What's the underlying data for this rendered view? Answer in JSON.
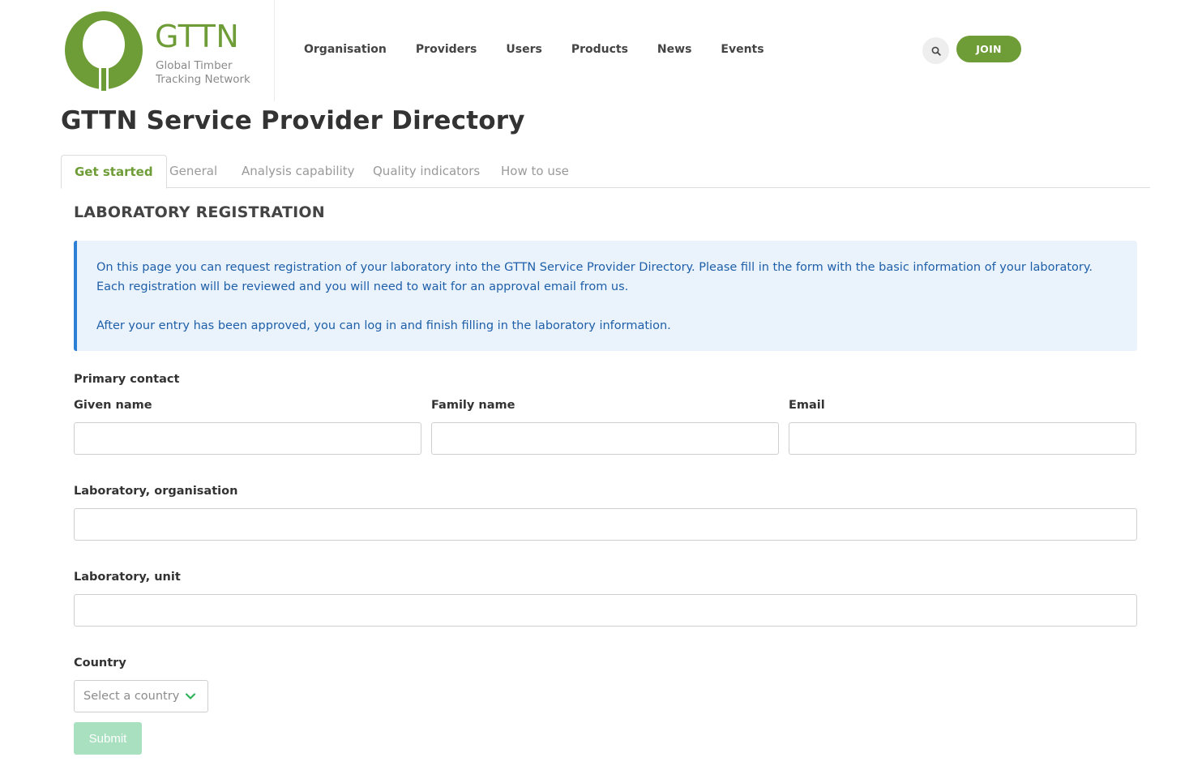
{
  "brand": {
    "name": "GTTN",
    "subtitle_line1": "Global Timber",
    "subtitle_line2": "Tracking Network",
    "color": "#6e9c36"
  },
  "nav": {
    "items": [
      {
        "label": "Organisation"
      },
      {
        "label": "Providers"
      },
      {
        "label": "Users"
      },
      {
        "label": "Products"
      },
      {
        "label": "News"
      },
      {
        "label": "Events"
      }
    ],
    "search_icon": "search-icon",
    "join_label": "JOIN"
  },
  "page": {
    "title": "GTTN Service Provider Directory"
  },
  "tabs": [
    {
      "label": "Get started",
      "active": true
    },
    {
      "label": "General",
      "active": false
    },
    {
      "label": "Analysis capability",
      "active": false
    },
    {
      "label": "Quality indicators",
      "active": false
    },
    {
      "label": "How to use",
      "active": false
    }
  ],
  "section": {
    "title": "LABORATORY REGISTRATION"
  },
  "info": {
    "paragraph1": "On this page you can request registration of your laboratory into the GTTN Service Provider Directory. Please fill in the form with the basic information of your laboratory. Each registration will be reviewed and you will need to wait for an approval email from us.",
    "paragraph2": "After your entry has been approved, you can log in and finish filling in the laboratory information."
  },
  "form": {
    "primary_contact_label": "Primary contact",
    "given_name_label": "Given name",
    "given_name_value": "",
    "family_name_label": "Family name",
    "family_name_value": "",
    "email_label": "Email",
    "email_value": "",
    "organisation_label": "Laboratory, organisation",
    "organisation_value": "",
    "unit_label": "Laboratory, unit",
    "unit_value": "",
    "country_label": "Country",
    "country_placeholder": "Select a country",
    "submit_label": "Submit"
  },
  "colors": {
    "accent": "#6e9c36",
    "info_text": "#1e5fa8",
    "info_bg": "#eaf3fc",
    "info_border": "#2b7fd4",
    "submit_bg": "#a8e0c0"
  }
}
